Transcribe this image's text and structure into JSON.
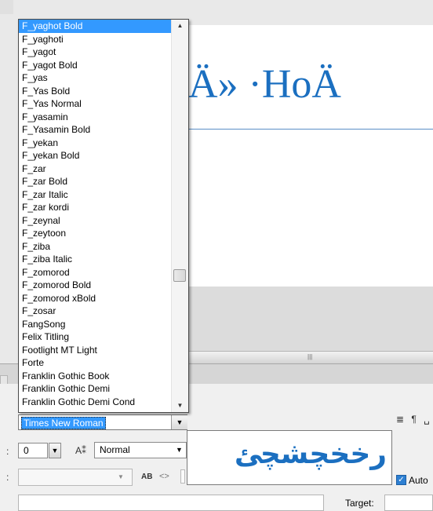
{
  "canvas": {
    "display_text": "Ä» ·HoÄ"
  },
  "font_list": {
    "items": [
      {
        "label": "F_yaghot Bold",
        "selected": true
      },
      {
        "label": "F_yaghoti"
      },
      {
        "label": "F_yagot"
      },
      {
        "label": "F_yagot Bold"
      },
      {
        "label": "F_yas"
      },
      {
        "label": "F_Yas Bold"
      },
      {
        "label": "F_Yas Normal"
      },
      {
        "label": "F_yasamin"
      },
      {
        "label": "F_Yasamin Bold"
      },
      {
        "label": "F_yekan"
      },
      {
        "label": "F_yekan Bold"
      },
      {
        "label": "F_zar"
      },
      {
        "label": "F_zar Bold"
      },
      {
        "label": "F_zar Italic"
      },
      {
        "label": "F_zar kordi"
      },
      {
        "label": "F_zeynal"
      },
      {
        "label": "F_zeytoon"
      },
      {
        "label": "F_ziba"
      },
      {
        "label": "F_ziba Italic"
      },
      {
        "label": "F_zomorod"
      },
      {
        "label": "F_zomorod Bold"
      },
      {
        "label": "F_zomorod xBold"
      },
      {
        "label": "F_zosar"
      },
      {
        "label": "FangSong"
      },
      {
        "label": "Felix Titling"
      },
      {
        "label": "Footlight MT Light"
      },
      {
        "label": "Forte"
      },
      {
        "label": "Franklin Gothic Book"
      },
      {
        "label": "Franklin Gothic Demi"
      },
      {
        "label": "Franklin Gothic Demi Cond"
      }
    ]
  },
  "font_combo": {
    "value": "Times New Roman"
  },
  "size_field": {
    "value": "0"
  },
  "spacing_select": {
    "value": "Normal"
  },
  "preview": {
    "text": "رخخچشچئ"
  },
  "auto_label": "Auto",
  "target_label": "Target:",
  "icons": {
    "scroll_up": "▲",
    "scroll_down": "▼",
    "dropdown": "▼",
    "kerning": "A⁑",
    "ab": "AB",
    "direction": "<>",
    "paragraph": "≣ ¶ ␣",
    "hgrip": "|||",
    "check": "✓"
  }
}
